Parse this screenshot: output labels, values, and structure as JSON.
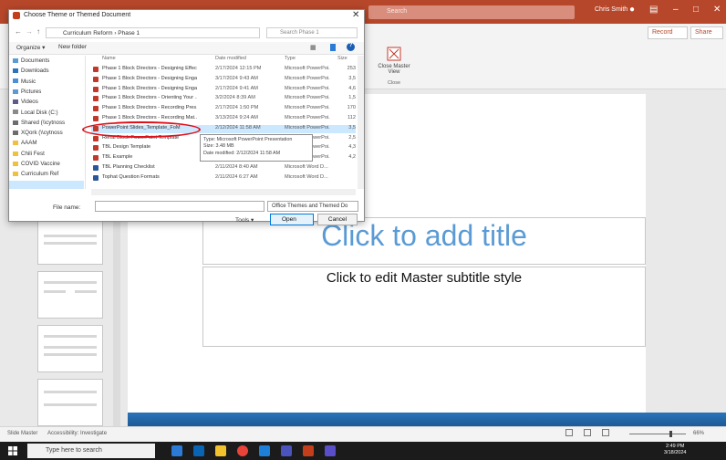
{
  "powerpoint": {
    "search_placeholder": "Search",
    "user_name": "Chris Smith",
    "record_label": "Record",
    "share_label": "Share",
    "close_master_label": "Close Master View",
    "close_group_label": "Close",
    "title_placeholder": "Click to add title",
    "subtitle_placeholder": "Click to edit Master subtitle style",
    "status_slide": "Slide Master",
    "status_accessibility": "Accessibility: Investigate",
    "status_zoom": "66%"
  },
  "dialog": {
    "title": "Choose Theme or Themed Document",
    "breadcrumb": "Curriculum Reform  ›  Phase 1",
    "search_placeholder": "Search Phase 1",
    "organize_label": "Organize ▾",
    "new_folder_label": "New folder",
    "nav_items": [
      {
        "label": "Documents",
        "color": "#5b9bd5"
      },
      {
        "label": "Downloads",
        "color": "#2a74b8"
      },
      {
        "label": "Music",
        "color": "#4a90d9"
      },
      {
        "label": "Pictures",
        "color": "#5b9bd5"
      },
      {
        "label": "Videos",
        "color": "#5b5b8d"
      },
      {
        "label": "Local Disk (C:)",
        "color": "#8a8a8a"
      },
      {
        "label": "Shared (\\\\cytnoss",
        "color": "#6d6d6d"
      },
      {
        "label": "XQork (\\\\cytnoss",
        "color": "#6d6d6d"
      },
      {
        "label": "AAAM",
        "color": "#f0c040"
      },
      {
        "label": "Chili Fest",
        "color": "#f0c040"
      },
      {
        "label": "COVID Vaccine",
        "color": "#f0c040"
      },
      {
        "label": "Curriculum Ref",
        "color": "#f0c040"
      }
    ],
    "columns": {
      "name": "Name",
      "date": "Date modified",
      "type": "Type",
      "size": "Size"
    },
    "files": [
      {
        "name": "Phase 1 Block Directors - Designing Effec...",
        "date": "2/17/2024 12:15 PM",
        "type": "Microsoft PowerPoi...",
        "size": "253"
      },
      {
        "name": "Phase 1 Block Directors - Designing Enga...",
        "date": "3/17/2024 9:43 AM",
        "type": "Microsoft PowerPoi...",
        "size": "3,5"
      },
      {
        "name": "Phase 1 Block Directors - Designing Enga...",
        "date": "2/17/2024 9:41 AM",
        "type": "Microsoft PowerPoi...",
        "size": "4,6"
      },
      {
        "name": "Phase 1 Block Directors - Orienting Your ...",
        "date": "3/2/2024 8:39 AM",
        "type": "Microsoft PowerPoi...",
        "size": "1,5"
      },
      {
        "name": "Phase 1 Block Directors - Recording Pres...",
        "date": "2/17/2024 1:50 PM",
        "type": "Microsoft PowerPoi...",
        "size": "170"
      },
      {
        "name": "Phase 1 Block Directors - Recording Mat...",
        "date": "3/13/2024 9:24 AM",
        "type": "Microsoft PowerPoi...",
        "size": "112"
      },
      {
        "name": "PowerPoint Slides_Template_FoM",
        "date": "2/12/2024 11:58 AM",
        "type": "Microsoft PowerPoi...",
        "size": "3,5"
      },
      {
        "name": "Renal Block PowerPoint Template",
        "date": "2/12/2024 11:58 AM",
        "type": "Microsoft PowerPoi...",
        "size": "2,5"
      },
      {
        "name": "TBL Design Template",
        "date": "2/17/2024 8:40 AM",
        "type": "Microsoft PowerPoi...",
        "size": "4,3"
      },
      {
        "name": "TBL Example",
        "date": "2/17/2024 8:42 AM",
        "type": "Microsoft PowerPoi...",
        "size": "4,2"
      },
      {
        "name": "TBL Planning Checklist",
        "date": "2/11/2024 8:40 AM",
        "type": "Microsoft Word D...",
        "size": ""
      },
      {
        "name": "Tophat Question Formats",
        "date": "2/11/2024 6:27 AM",
        "type": "Microsoft Word D...",
        "size": ""
      }
    ],
    "tooltip": {
      "type": "Type: Microsoft PowerPoint Presentation",
      "size": "Size: 3.48 MB",
      "modified": "Date modified: 2/12/2024 11:58 AM"
    },
    "filename_label": "File name:",
    "filename_value": "",
    "filetype_value": "Office Themes and Themed Do",
    "tools_label": "Tools  ▾",
    "open_label": "Open",
    "cancel_label": "Cancel"
  },
  "taskbar": {
    "search_placeholder": "Type here to search",
    "time": "2:49 PM",
    "date": "3/18/2024"
  }
}
